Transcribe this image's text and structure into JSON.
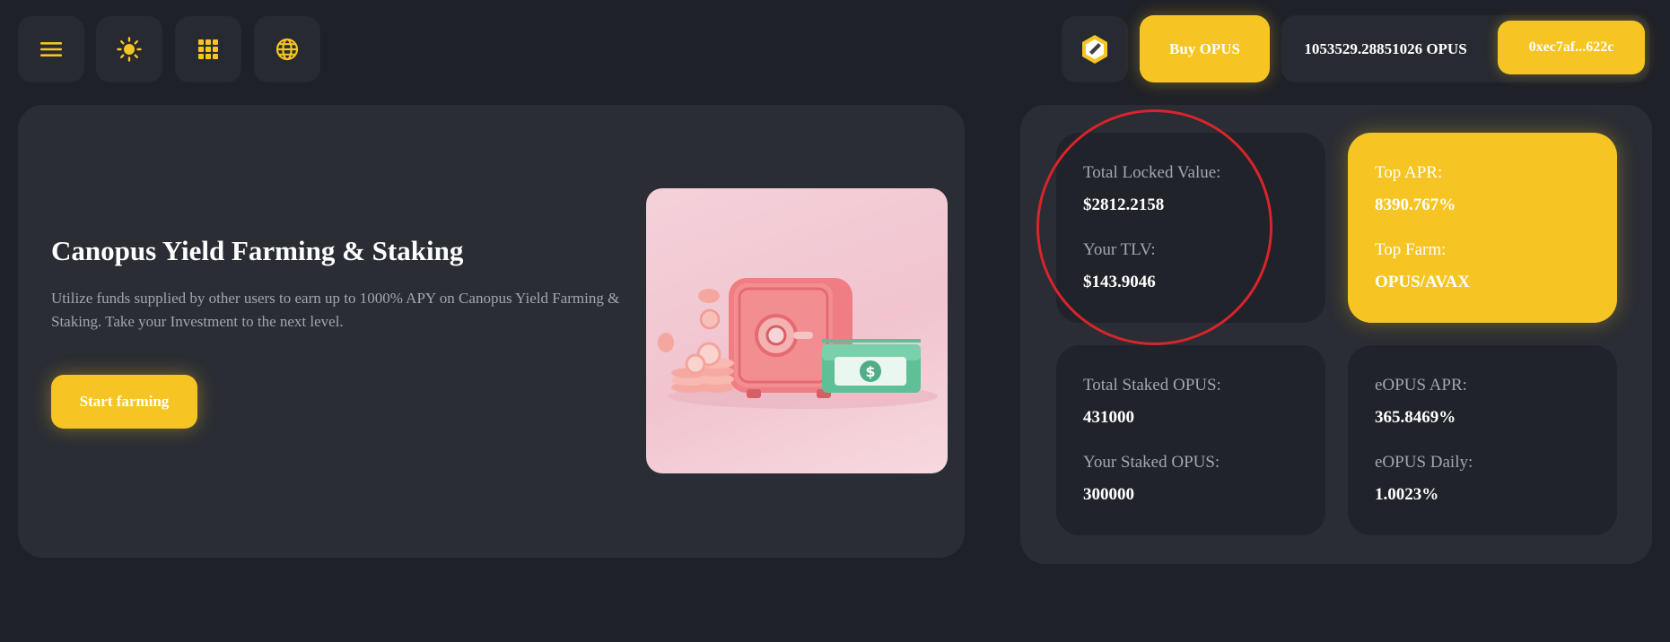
{
  "topbar": {
    "buttons": [
      {
        "icon": "menu-icon"
      },
      {
        "icon": "sun-icon"
      },
      {
        "icon": "grid-icon"
      },
      {
        "icon": "globe-icon"
      }
    ],
    "logo_icon": "canopus-logo-icon",
    "buy_label": "Buy OPUS",
    "balance": "1053529.28851026 OPUS",
    "address": "0xec7af...622c"
  },
  "hero": {
    "title": "Canopus Yield Farming & Staking",
    "description": "Utilize funds supplied by other users to earn up to 1000% APY on Canopus Yield Farming & Staking. Take your Investment to the next level.",
    "cta_label": "Start farming",
    "image": "safe-with-coins-and-cash-illustration"
  },
  "stats": {
    "tlv_card": {
      "label1": "Total Locked Value:",
      "value1": "$2812.2158",
      "label2": "Your TLV:",
      "value2": "$143.9046"
    },
    "apr_card": {
      "label1": "Top APR:",
      "value1": "8390.767%",
      "label2": "Top Farm:",
      "value2": "OPUS/AVAX"
    },
    "staked_card": {
      "label1": "Total Staked OPUS:",
      "value1": "431000",
      "label2": "Your Staked OPUS:",
      "value2": "300000"
    },
    "eopus_card": {
      "label1": "eOPUS APR:",
      "value1": "365.8469%",
      "label2": "eOPUS Daily:",
      "value2": "1.0023%"
    }
  },
  "colors": {
    "background": "#1f2128",
    "card": "#2a2d34",
    "inner_card": "#20232a",
    "accent": "#f6c523",
    "annotation": "#d8242b"
  }
}
